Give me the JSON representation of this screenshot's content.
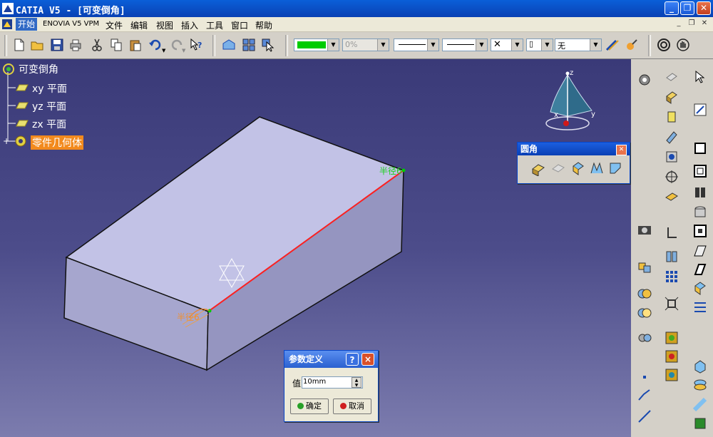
{
  "window": {
    "title": "CATIA V5 - [可变倒角]"
  },
  "menu": {
    "items": [
      "开始",
      "ENOVIA V5 VPM",
      "文件",
      "编辑",
      "视图",
      "插入",
      "工具",
      "窗口",
      "帮助"
    ],
    "active_index": 0
  },
  "toolbar": {
    "color_value": "#00cc00",
    "transparency_value": "0%",
    "layer_value": "无"
  },
  "tree": {
    "root": "可变倒角",
    "planes": [
      "xy 平面",
      "yz 平面",
      "zx 平面"
    ],
    "body": "零件几何体"
  },
  "compass": {
    "x_label": "x",
    "y_label": "y",
    "z_label": "z"
  },
  "annotations": {
    "radius_right": "半径6",
    "radius_left": "半径6"
  },
  "chamfer_toolbar": {
    "title": "圆角"
  },
  "param_dialog": {
    "title": "参数定义",
    "help_label": "?",
    "close_label": "×",
    "value_label": "值",
    "value": "10mm",
    "ok_label": "确定",
    "cancel_label": "取消"
  },
  "colors": {
    "accent_edge": "#ff2020",
    "selection": "#f28a1e",
    "background_top": "#3a3a78"
  }
}
